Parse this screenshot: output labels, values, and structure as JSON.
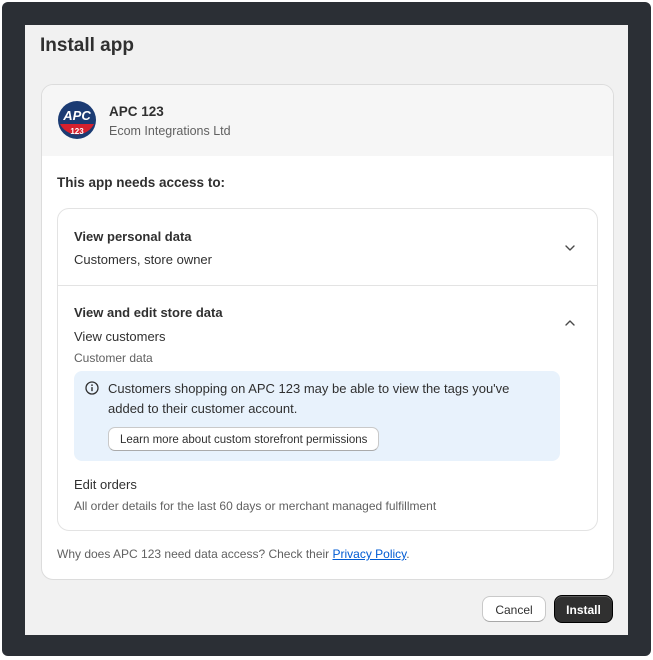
{
  "modal": {
    "title": "Install app"
  },
  "app": {
    "name": "APC 123",
    "developer": "Ecom Integrations Ltd",
    "logo_text_top": "APC",
    "logo_text_bottom": "123",
    "logo_colors": {
      "navy": "#1b3b73",
      "red": "#d6212e"
    }
  },
  "access": {
    "heading": "This app needs access to:",
    "permissions": [
      {
        "title": "View personal data",
        "summary": "Customers, store owner",
        "expanded": false,
        "icon": "chevron-down-icon"
      },
      {
        "title": "View and edit store data",
        "expanded": true,
        "icon": "chevron-up-icon",
        "groups": [
          {
            "label": "View customers",
            "detail": "Customer data",
            "notice": {
              "icon": "info-icon",
              "text": "Customers shopping on APC 123 may be able to view the tags you've added to their customer account.",
              "button": "Learn more about custom storefront permissions"
            }
          },
          {
            "label": "Edit orders",
            "detail": "All order details for the last 60 days or merchant managed fulfillment"
          }
        ]
      }
    ]
  },
  "privacy": {
    "prefix": "Why does APC 123 need data access? Check their ",
    "link": "Privacy Policy",
    "suffix": "."
  },
  "footer": {
    "cancel": "Cancel",
    "install": "Install"
  },
  "colors": {
    "backdrop": "#2b2f35",
    "modal_bg": "#f1f1f1",
    "info_bg": "#e8f2fc",
    "link": "#005bd3",
    "primary_button": "#303030"
  }
}
